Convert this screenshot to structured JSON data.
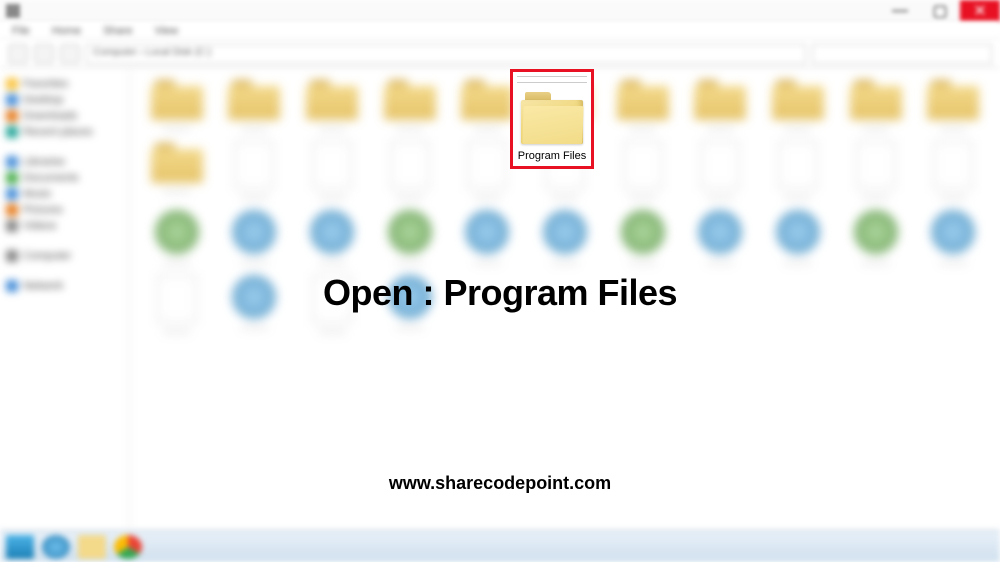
{
  "window": {
    "close_symbol": "✕",
    "max_symbol": "▢",
    "min_symbol": "—"
  },
  "ribbon": {
    "tabs": [
      "File",
      "Home",
      "Share",
      "View"
    ]
  },
  "nav": {
    "breadcrumb": "Computer  ›  Local Disk (C:)"
  },
  "sidebar": {
    "groups": [
      {
        "items": [
          {
            "label": "Favorites",
            "ico": "ico-star"
          },
          {
            "label": "Desktop",
            "ico": "ico-blue"
          },
          {
            "label": "Downloads",
            "ico": "ico-orange"
          },
          {
            "label": "Recent places",
            "ico": "ico-teal"
          }
        ]
      },
      {
        "items": [
          {
            "label": "Libraries",
            "ico": "ico-blue"
          },
          {
            "label": "Documents",
            "ico": "ico-green"
          },
          {
            "label": "Music",
            "ico": "ico-blue"
          },
          {
            "label": "Pictures",
            "ico": "ico-orange"
          },
          {
            "label": "Videos",
            "ico": "ico-grey"
          }
        ]
      },
      {
        "items": [
          {
            "label": "Computer",
            "ico": "ico-grey"
          }
        ]
      },
      {
        "items": [
          {
            "label": "Network",
            "ico": "ico-blue"
          }
        ]
      }
    ]
  },
  "highlight": {
    "label": "Program Files"
  },
  "overlay": {
    "instruction": "Open : Program Files",
    "url": "www.sharecodepoint.com"
  },
  "grid": {
    "row1_count": 11,
    "row2_folders": 1,
    "row2_files": 10,
    "row3_sys": 11,
    "row4_sys": 4
  }
}
